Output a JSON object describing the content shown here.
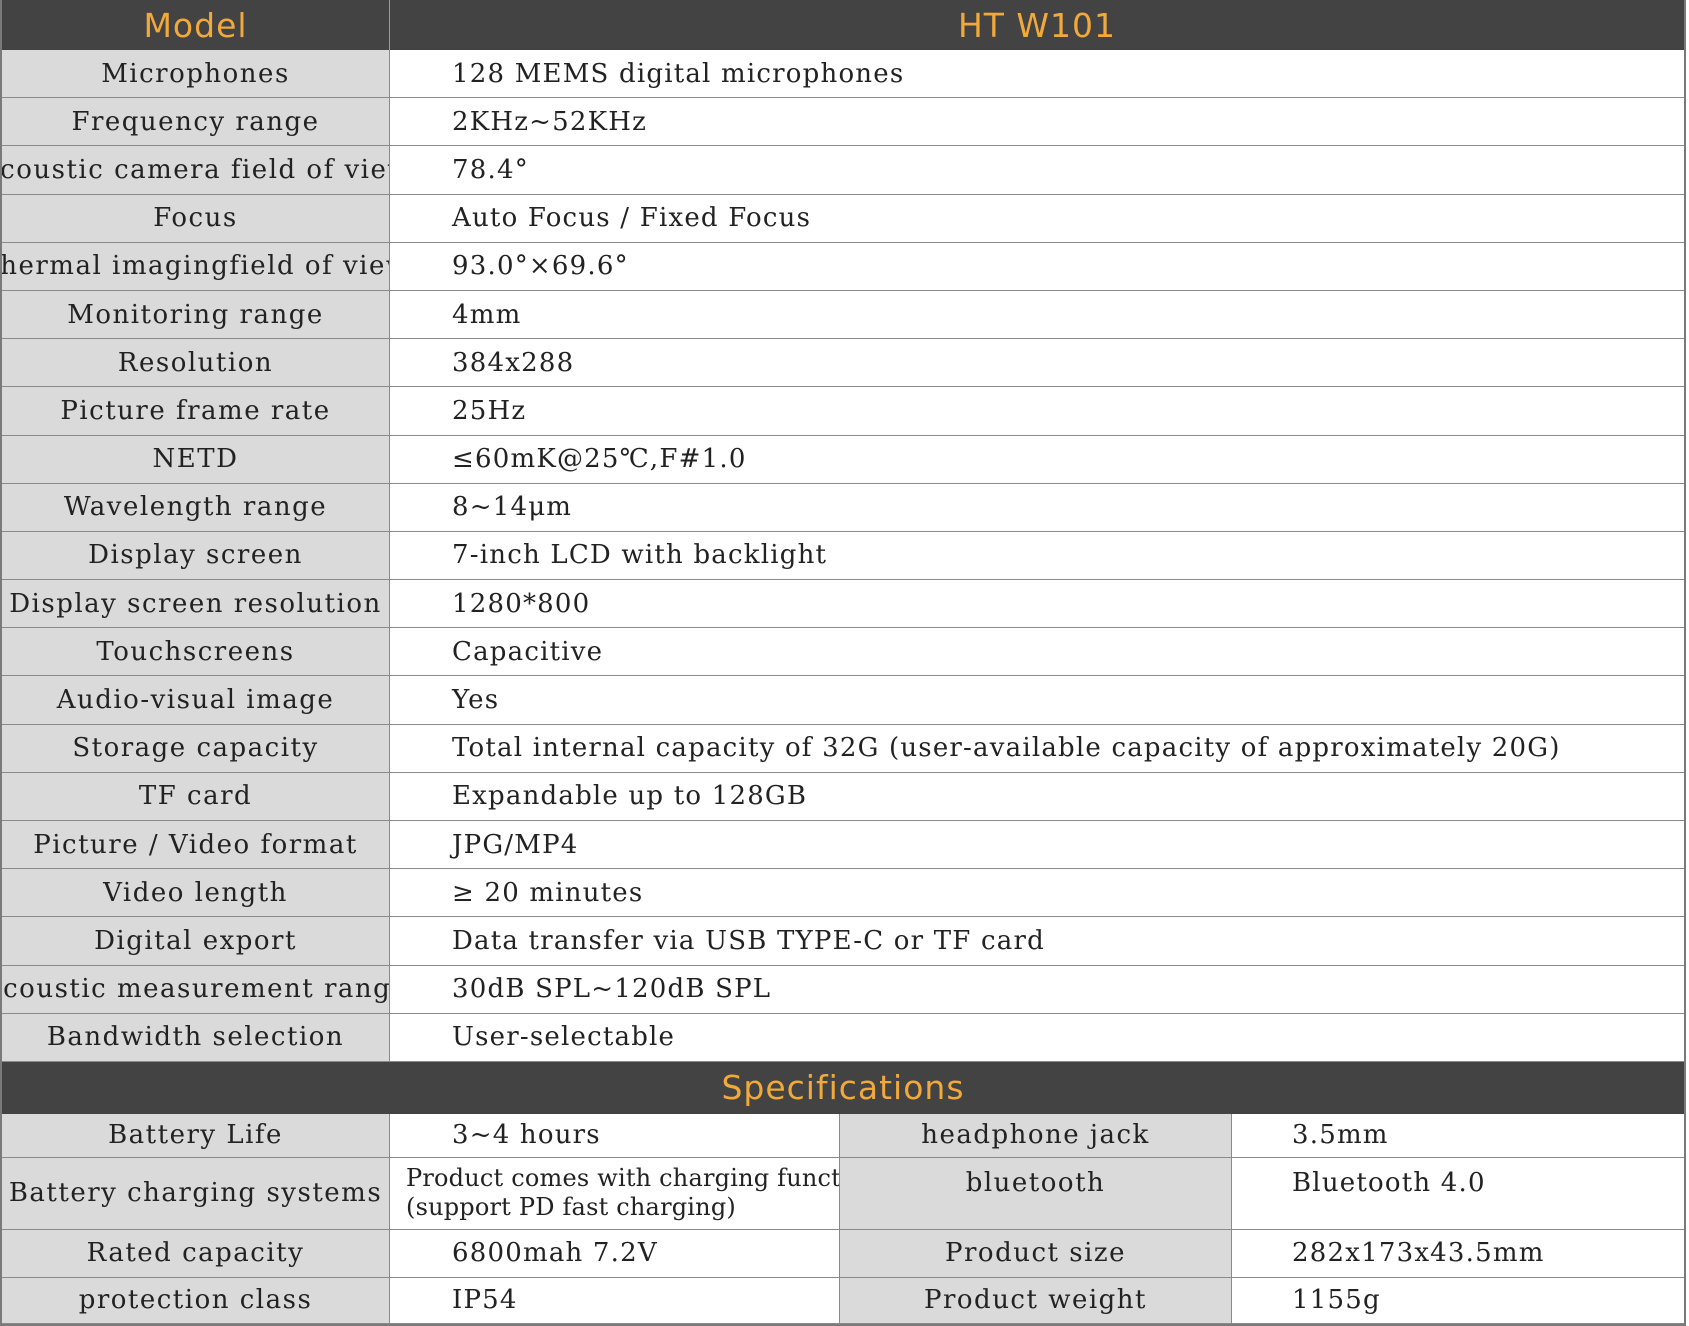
{
  "header": {
    "model_label": "Model",
    "model_value": "HT W101"
  },
  "specs": [
    {
      "label": "Microphones",
      "value": "128 MEMS digital microphones"
    },
    {
      "label": "Frequency range",
      "value": "2KHz~52KHz"
    },
    {
      "label": "Acoustic camera field of view",
      "value": "78.4°"
    },
    {
      "label": "Focus",
      "value": "Auto Focus / Fixed Focus"
    },
    {
      "label": "Thermal imagingfield of view",
      "value": "93.0°×69.6°"
    },
    {
      "label": "Monitoring range",
      "value": "4mm"
    },
    {
      "label": "Resolution",
      "value": "384x288"
    },
    {
      "label": "Picture frame rate",
      "value": "25Hz"
    },
    {
      "label": "NETD",
      "value": "≤60mK@25℃,F#1.0"
    },
    {
      "label": "Wavelength range",
      "value": "8~14μm"
    },
    {
      "label": "Display screen",
      "value": "7-inch LCD with backlight"
    },
    {
      "label": "Display screen resolution",
      "value": "1280*800"
    },
    {
      "label": "Touchscreens",
      "value": "Capacitive"
    },
    {
      "label": "Audio-visual image",
      "value": "Yes"
    },
    {
      "label": "Storage capacity",
      "value": "Total internal capacity of 32G (user-available capacity of approximately 20G)"
    },
    {
      "label": "TF card",
      "value": "Expandable up to 128GB"
    },
    {
      "label": "Picture / Video format",
      "value": "JPG/MP4"
    },
    {
      "label": "Video length",
      "value": "≥ 20 minutes"
    },
    {
      "label": "Digital export",
      "value": "Data transfer via USB TYPE-C or TF card"
    },
    {
      "label": "Acoustic measurement range",
      "value": "30dB SPL~120dB SPL"
    },
    {
      "label": "Bandwidth selection",
      "value": "User-selectable"
    }
  ],
  "section": {
    "title": "Specifications"
  },
  "bottom": [
    {
      "label": "Battery Life",
      "value": "3~4 hours",
      "label2": "headphone jack",
      "value2": "3.5mm"
    },
    {
      "label": "Battery charging systems",
      "value_line1": "Product comes with charging function",
      "value_line2": "(support PD fast charging)",
      "label2": "bluetooth",
      "value2": "Bluetooth 4.0"
    },
    {
      "label": "Rated capacity",
      "value": "6800mah 7.2V",
      "label2": "Product size",
      "value2": "282x173x43.5mm"
    },
    {
      "label": "protection class",
      "value": "IP54",
      "label2": "Product weight",
      "value2": "1155g"
    }
  ]
}
